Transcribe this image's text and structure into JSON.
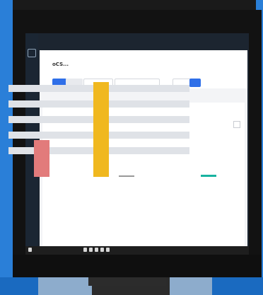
{
  "app": {
    "title": "oCS... ",
    "subtitle": "",
    "tabs": [
      "",
      "",
      "",
      ""
    ],
    "chips": [
      "",
      "",
      "",
      ""
    ]
  },
  "panel": {
    "title": ""
  },
  "chart_data": {
    "type": "bar",
    "categories": [
      "",
      "",
      "",
      ""
    ],
    "values": [
      20,
      52,
      0,
      1
    ],
    "colors": [
      "#e27b7b",
      "#f0b81f",
      "#999999",
      "#18b3a0"
    ],
    "ylim": [
      0,
      55
    ],
    "grid": true
  },
  "taskbar": {
    "left": "",
    "right": ""
  },
  "brand": ""
}
